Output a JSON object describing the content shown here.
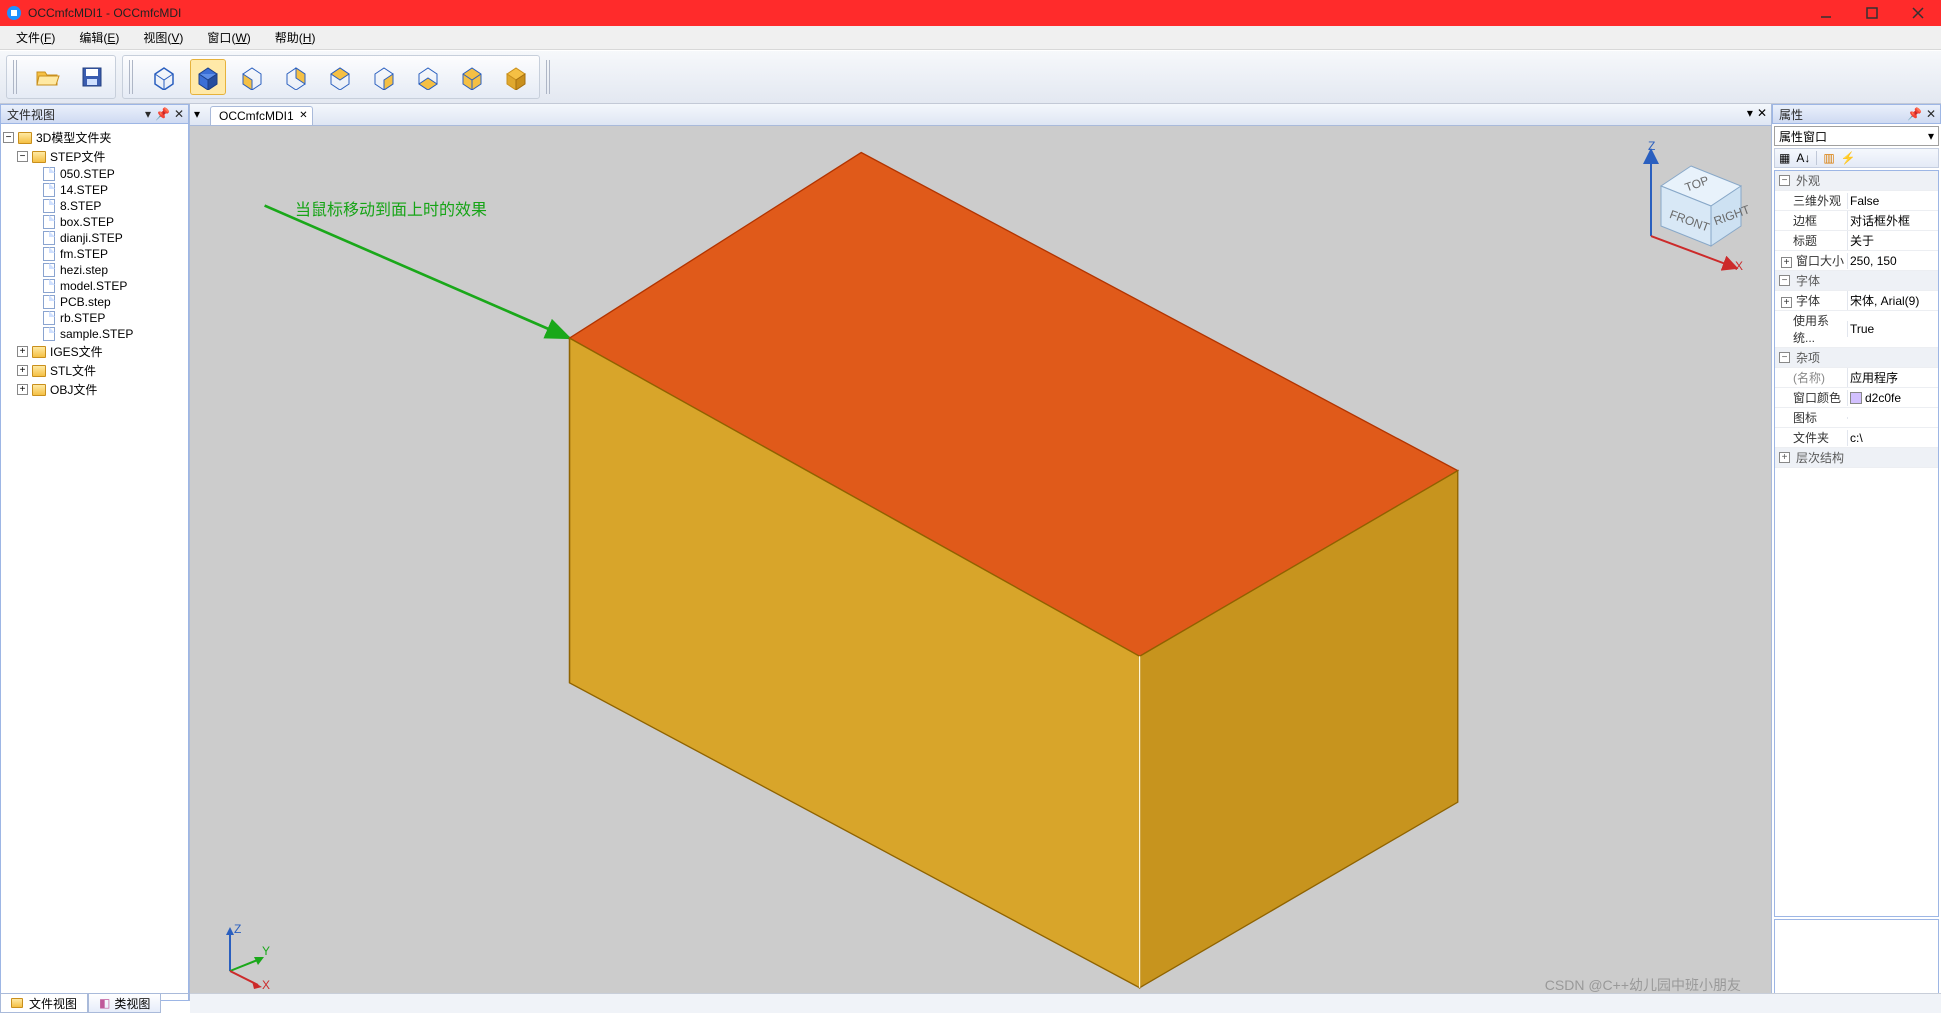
{
  "window": {
    "title": "OCCmfcMDI1 - OCCmfcMDI"
  },
  "menu": {
    "file": "文件",
    "file_u": "F",
    "edit": "编辑",
    "edit_u": "E",
    "view": "视图",
    "view_u": "V",
    "wind": "窗口",
    "wind_u": "W",
    "help": "帮助",
    "help_u": "H"
  },
  "panels": {
    "fileview_title": "文件视图",
    "tab_fileview": "文件视图",
    "tab_classview": "类视图",
    "doc_tab": "OCCmfcMDI1",
    "props_title": "属性",
    "props_selector": "属性窗口"
  },
  "tree": {
    "root": "3D模型文件夹",
    "step_folder": "STEP文件",
    "step_files": [
      "050.STEP",
      "14.STEP",
      "8.STEP",
      "box.STEP",
      "dianji.STEP",
      "fm.STEP",
      "hezi.step",
      "model.STEP",
      "PCB.step",
      "rb.STEP",
      "sample.STEP"
    ],
    "iges_folder": "IGES文件",
    "stl_folder": "STL文件",
    "obj_folder": "OBJ文件"
  },
  "annotation": "当鼠标移动到面上时的效果",
  "viewcube": {
    "top": "TOP",
    "front": "FRONT",
    "right": "RIGHT",
    "z": "Z",
    "x": "X"
  },
  "triad": {
    "x": "X",
    "y": "Y",
    "z": "Z"
  },
  "properties": {
    "cat_appearance": "外观",
    "appearance_3d_k": "三维外观",
    "appearance_3d_v": "False",
    "border_k": "边框",
    "border_v": "对话框外框",
    "title_k": "标题",
    "title_v": "关于",
    "winsize_k": "窗口大小",
    "winsize_v": "250, 150",
    "cat_font": "字体",
    "font_k": "字体",
    "font_v": "宋体, Arial(9)",
    "usesys_k": "使用系统...",
    "usesys_v": "True",
    "cat_misc": "杂项",
    "name_k": "(名称)",
    "name_v": "应用程序",
    "wincolor_k": "窗口颜色",
    "wincolor_v": "d2c0fe",
    "wincolor_hex": "#d2c0fe",
    "icon_k": "图标",
    "icon_v": "",
    "folder_k": "文件夹",
    "folder_v": "c:\\",
    "cat_hierarchy": "层次结构"
  },
  "watermark": "CSDN @C++幼儿园中班小朋友"
}
